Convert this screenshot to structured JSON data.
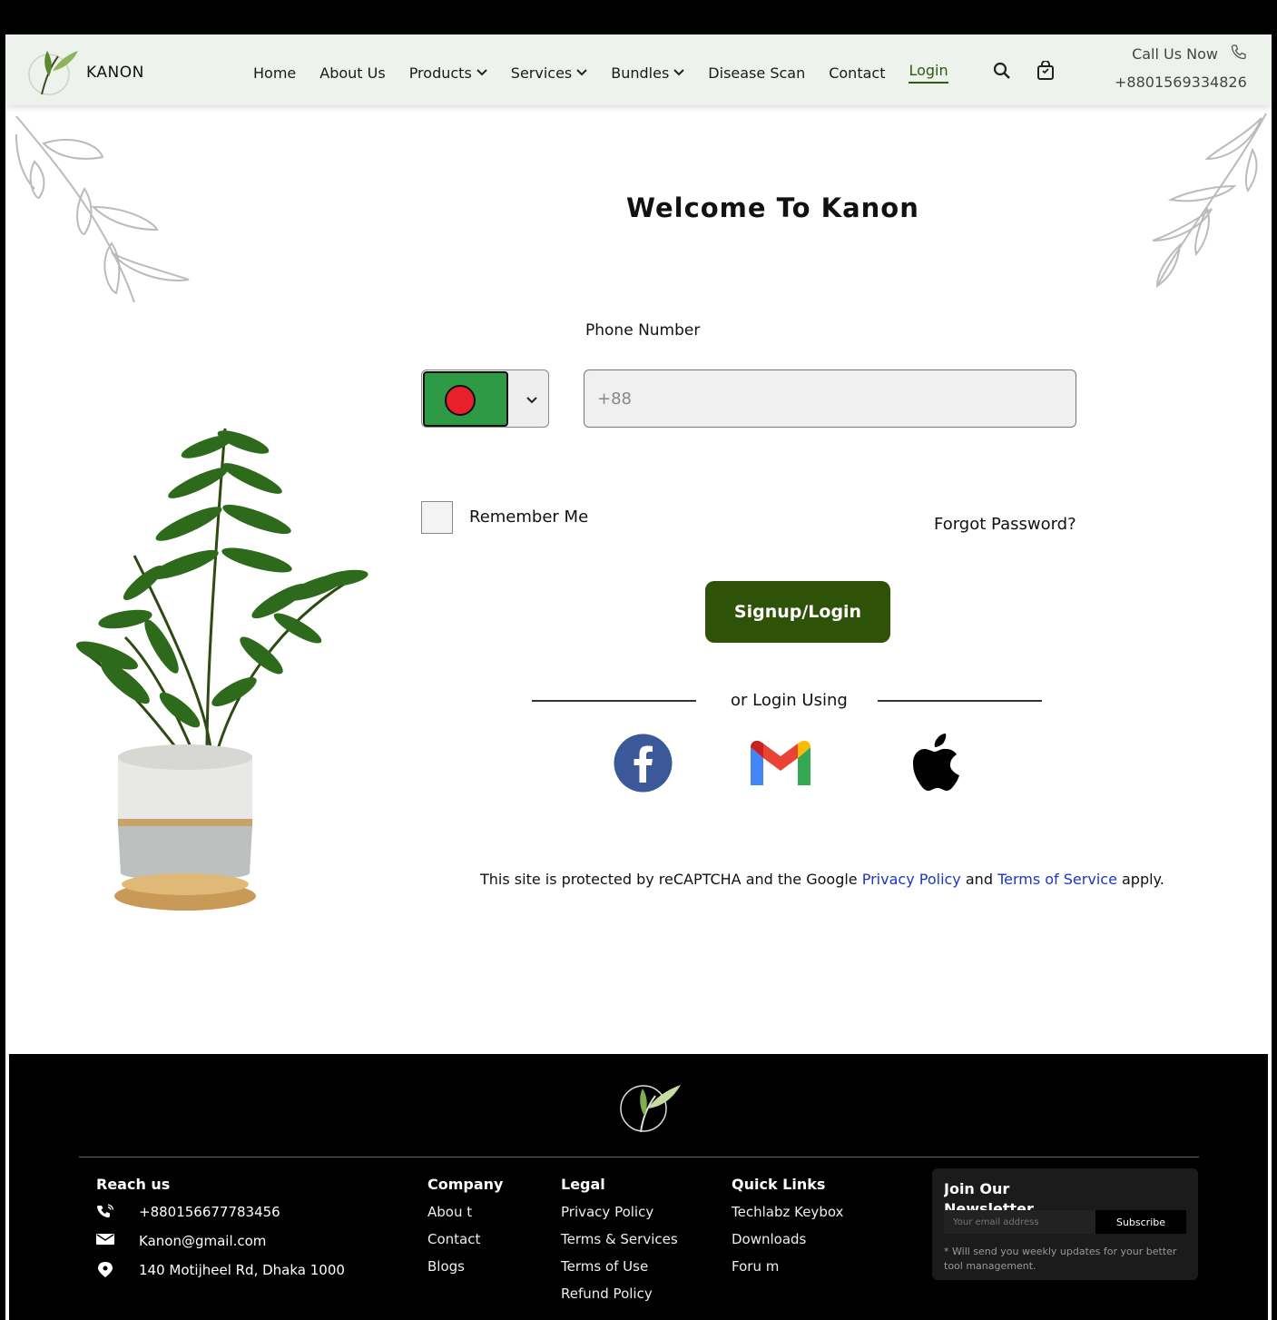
{
  "nav": {
    "brand": "KANON",
    "links": [
      "Home",
      "About Us",
      "Products",
      "Services",
      "Bundles",
      "Disease Scan",
      "Contact",
      "Login"
    ],
    "call_label": "Call Us Now",
    "call_number": "+8801569334826"
  },
  "main": {
    "title": "Welcome To Kanon",
    "phone_label": "Phone Number",
    "phone_placeholder": "+88",
    "remember_label": "Remember Me",
    "forgot_label": "Forgot Password?",
    "submit_label": "Signup/Login",
    "or_label": "or Login Using",
    "recaptcha": {
      "prefix": "This site is protected by reCAPTCHA and the Google ",
      "privacy": "Privacy Policy",
      "and": " and ",
      "terms": "Terms of Service",
      "suffix": " apply."
    }
  },
  "footer": {
    "reach_title": "Reach us",
    "reach_phone": "+880156677783456",
    "reach_email": "Kanon@gmail.com",
    "reach_address": "140 Motijheel Rd, Dhaka 1000",
    "company_title": "Company",
    "company_items": [
      "Abou t",
      "Contact",
      "Blogs"
    ],
    "legal_title": "Legal",
    "legal_items": [
      "Privacy Policy",
      "Terms & Services",
      "Terms of Use",
      "Refund Policy"
    ],
    "quick_title": "Quick Links",
    "quick_items": [
      "Techlabz Keybox",
      "Downloads",
      "Foru m"
    ],
    "news_title": "Join Our Newsletter",
    "news_placeholder": "Your email address",
    "news_button": "Subscribe",
    "news_note": "* Will send you weekly updates for your better tool management."
  },
  "colors": {
    "nav_bg": "#edf3ec",
    "accent_green": "#2e5208",
    "link_blue": "#1a35c8",
    "flag_green": "#2f9a45",
    "flag_red": "#e8202b"
  }
}
